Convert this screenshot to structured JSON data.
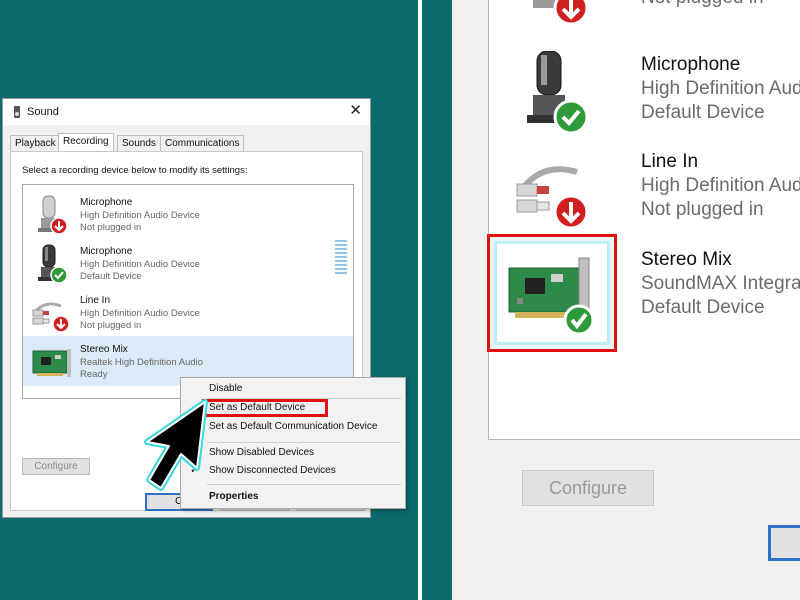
{
  "dialog": {
    "title": "Sound",
    "close_glyph": "✕",
    "tabs": [
      {
        "label": "Playback"
      },
      {
        "label": "Recording"
      },
      {
        "label": "Sounds"
      },
      {
        "label": "Communications"
      }
    ],
    "instruction": "Select a recording device below to modify its settings:",
    "devices": [
      {
        "name": "Microphone",
        "description": "High Definition Audio Device",
        "status": "Not plugged in",
        "icon": "microphone-icon",
        "badge": "unplugged-badge"
      },
      {
        "name": "Microphone",
        "description": "High Definition Audio Device",
        "status": "Default Device",
        "icon": "microphone-icon",
        "badge": "default-check-badge"
      },
      {
        "name": "Line In",
        "description": "High Definition Audio Device",
        "status": "Not plugged in",
        "icon": "line-in-cable-icon",
        "badge": "unplugged-badge"
      },
      {
        "name": "Stereo Mix",
        "description": "Realtek High Definition Audio",
        "status": "Ready",
        "icon": "sound-card-icon",
        "badge": ""
      }
    ],
    "configure_label": "Configure",
    "ok_label": "O"
  },
  "context_menu": {
    "items": {
      "disable": "Disable",
      "set_default": "Set as Default Device",
      "set_default_comm": "Set as Default Communication Device",
      "show_disabled": "Show Disabled Devices",
      "show_disconnected": "Show Disconnected Devices",
      "properties": "Properties"
    },
    "check_glyph": "✓"
  },
  "zoom": {
    "devices": [
      {
        "name": "",
        "description": "",
        "status": "Not plugged in"
      },
      {
        "name": "Microphone",
        "description": "High Definition Aud",
        "status": "Default Device"
      },
      {
        "name": "Line In",
        "description": "High Definition Aud",
        "status": "Not plugged in"
      },
      {
        "name": "Stereo Mix",
        "description": "SoundMAX Integrat",
        "status": "Default Device"
      }
    ],
    "configure_label": "Configure"
  },
  "colors": {
    "background": "#0b6b6b",
    "highlight": "#e01010",
    "check_green": "#2f9a3a",
    "unplug_red": "#d11f1f",
    "selection": "#dceaf7"
  }
}
